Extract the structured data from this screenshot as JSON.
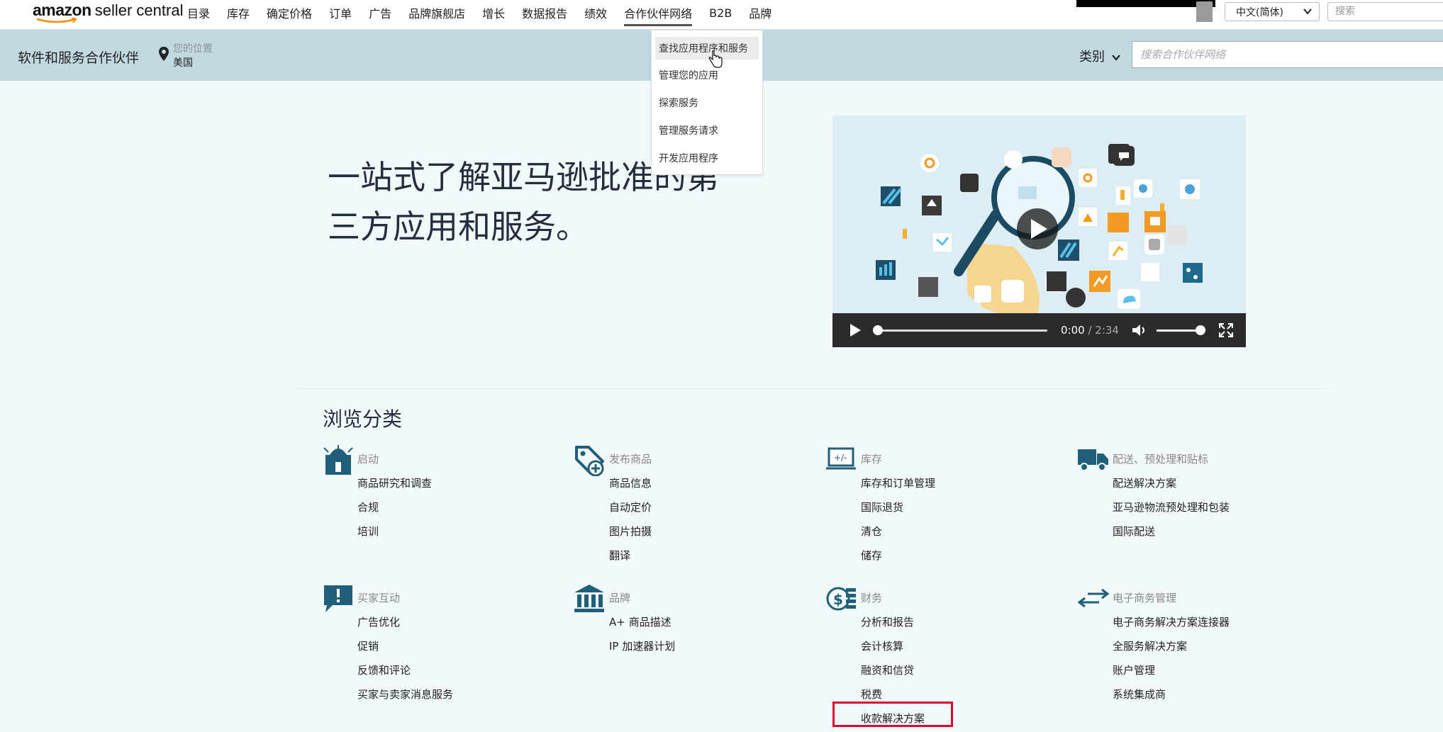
{
  "topnav": {
    "logo_amazon": "amazon",
    "logo_sc": "seller central",
    "items": [
      "目录",
      "库存",
      "确定价格",
      "订单",
      "广告",
      "品牌旗舰店",
      "增长",
      "数据报告",
      "绩效",
      "合作伙伴网络",
      "B2B",
      "品牌"
    ],
    "active_item": "合作伙伴网络",
    "language": "中文(简体)",
    "search_placeholder": "搜索"
  },
  "subheader": {
    "title": "软件和服务合作伙伴",
    "location_label": "您的位置",
    "location_value": "美国",
    "category_label": "类别",
    "search_placeholder": "搜索合作伙伴网络"
  },
  "dropdown": {
    "items": [
      "查找应用程序和服务",
      "管理您的应用",
      "探索服务",
      "管理服务请求",
      "开发应用程序"
    ],
    "hovered": "查找应用程序和服务"
  },
  "hero": {
    "line1": "一站式了解亚马逊批准的第",
    "line2": "三方应用和服务。"
  },
  "video": {
    "current_time": "0:00",
    "total_time": "/ 2:34",
    "progress": 0,
    "volume": 0.9
  },
  "browse": {
    "title": "浏览分类",
    "categories": [
      {
        "name": "启动",
        "icon": "launch-icon",
        "links": [
          "商品研究和调查",
          "合规",
          "培训"
        ]
      },
      {
        "name": "发布商品",
        "icon": "tag-icon",
        "links": [
          "商品信息",
          "自动定价",
          "图片拍摄",
          "翻译"
        ]
      },
      {
        "name": "库存",
        "icon": "inventory-icon",
        "links": [
          "库存和订单管理",
          "国际退货",
          "清仓",
          "储存"
        ]
      },
      {
        "name": "配送、预处理和贴标",
        "icon": "truck-icon",
        "links": [
          "配送解决方案",
          "亚马逊物流预处理和包装",
          "国际配送"
        ]
      },
      {
        "name": "买家互动",
        "icon": "chat-alert-icon",
        "links": [
          "广告优化",
          "促销",
          "反馈和评论",
          "买家与卖家消息服务"
        ]
      },
      {
        "name": "品牌",
        "icon": "bank-icon",
        "links": [
          "A+ 商品描述",
          "IP 加速器计划"
        ]
      },
      {
        "name": "财务",
        "icon": "finance-icon",
        "links": [
          "分析和报告",
          "会计核算",
          "融资和信贷",
          "税费",
          "收款解决方案"
        ]
      },
      {
        "name": "电子商务管理",
        "icon": "exchange-icon",
        "links": [
          "电子商务解决方案连接器",
          "全服务解决方案",
          "账户管理",
          "系统集成商"
        ]
      }
    ]
  },
  "colors": {
    "subheader_bg": "#c2d9e1",
    "page_bg": "#f2f9fb",
    "icon_teal": "#1f5f7a",
    "highlight": "#e0002a"
  }
}
